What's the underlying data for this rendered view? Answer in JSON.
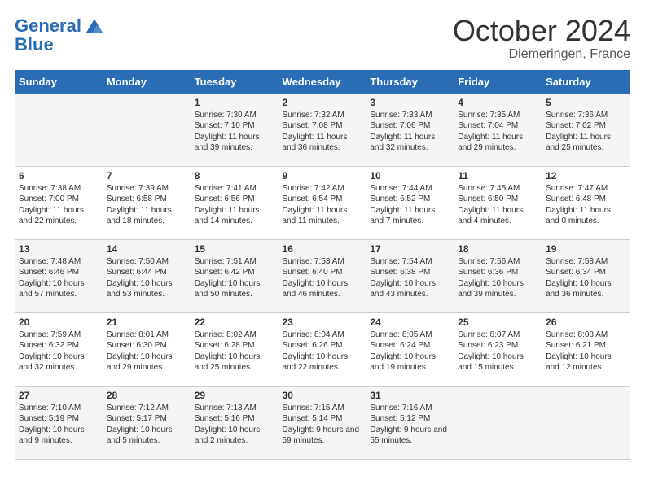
{
  "header": {
    "logo_line1": "General",
    "logo_line2": "Blue",
    "title": "October 2024",
    "subtitle": "Diemeringen, France"
  },
  "weekdays": [
    "Sunday",
    "Monday",
    "Tuesday",
    "Wednesday",
    "Thursday",
    "Friday",
    "Saturday"
  ],
  "weeks": [
    [
      {
        "day": "",
        "info": ""
      },
      {
        "day": "",
        "info": ""
      },
      {
        "day": "1",
        "info": "Sunrise: 7:30 AM\nSunset: 7:10 PM\nDaylight: 11 hours and 39 minutes."
      },
      {
        "day": "2",
        "info": "Sunrise: 7:32 AM\nSunset: 7:08 PM\nDaylight: 11 hours and 36 minutes."
      },
      {
        "day": "3",
        "info": "Sunrise: 7:33 AM\nSunset: 7:06 PM\nDaylight: 11 hours and 32 minutes."
      },
      {
        "day": "4",
        "info": "Sunrise: 7:35 AM\nSunset: 7:04 PM\nDaylight: 11 hours and 29 minutes."
      },
      {
        "day": "5",
        "info": "Sunrise: 7:36 AM\nSunset: 7:02 PM\nDaylight: 11 hours and 25 minutes."
      }
    ],
    [
      {
        "day": "6",
        "info": "Sunrise: 7:38 AM\nSunset: 7:00 PM\nDaylight: 11 hours and 22 minutes."
      },
      {
        "day": "7",
        "info": "Sunrise: 7:39 AM\nSunset: 6:58 PM\nDaylight: 11 hours and 18 minutes."
      },
      {
        "day": "8",
        "info": "Sunrise: 7:41 AM\nSunset: 6:56 PM\nDaylight: 11 hours and 14 minutes."
      },
      {
        "day": "9",
        "info": "Sunrise: 7:42 AM\nSunset: 6:54 PM\nDaylight: 11 hours and 11 minutes."
      },
      {
        "day": "10",
        "info": "Sunrise: 7:44 AM\nSunset: 6:52 PM\nDaylight: 11 hours and 7 minutes."
      },
      {
        "day": "11",
        "info": "Sunrise: 7:45 AM\nSunset: 6:50 PM\nDaylight: 11 hours and 4 minutes."
      },
      {
        "day": "12",
        "info": "Sunrise: 7:47 AM\nSunset: 6:48 PM\nDaylight: 11 hours and 0 minutes."
      }
    ],
    [
      {
        "day": "13",
        "info": "Sunrise: 7:48 AM\nSunset: 6:46 PM\nDaylight: 10 hours and 57 minutes."
      },
      {
        "day": "14",
        "info": "Sunrise: 7:50 AM\nSunset: 6:44 PM\nDaylight: 10 hours and 53 minutes."
      },
      {
        "day": "15",
        "info": "Sunrise: 7:51 AM\nSunset: 6:42 PM\nDaylight: 10 hours and 50 minutes."
      },
      {
        "day": "16",
        "info": "Sunrise: 7:53 AM\nSunset: 6:40 PM\nDaylight: 10 hours and 46 minutes."
      },
      {
        "day": "17",
        "info": "Sunrise: 7:54 AM\nSunset: 6:38 PM\nDaylight: 10 hours and 43 minutes."
      },
      {
        "day": "18",
        "info": "Sunrise: 7:56 AM\nSunset: 6:36 PM\nDaylight: 10 hours and 39 minutes."
      },
      {
        "day": "19",
        "info": "Sunrise: 7:58 AM\nSunset: 6:34 PM\nDaylight: 10 hours and 36 minutes."
      }
    ],
    [
      {
        "day": "20",
        "info": "Sunrise: 7:59 AM\nSunset: 6:32 PM\nDaylight: 10 hours and 32 minutes."
      },
      {
        "day": "21",
        "info": "Sunrise: 8:01 AM\nSunset: 6:30 PM\nDaylight: 10 hours and 29 minutes."
      },
      {
        "day": "22",
        "info": "Sunrise: 8:02 AM\nSunset: 6:28 PM\nDaylight: 10 hours and 25 minutes."
      },
      {
        "day": "23",
        "info": "Sunrise: 8:04 AM\nSunset: 6:26 PM\nDaylight: 10 hours and 22 minutes."
      },
      {
        "day": "24",
        "info": "Sunrise: 8:05 AM\nSunset: 6:24 PM\nDaylight: 10 hours and 19 minutes."
      },
      {
        "day": "25",
        "info": "Sunrise: 8:07 AM\nSunset: 6:23 PM\nDaylight: 10 hours and 15 minutes."
      },
      {
        "day": "26",
        "info": "Sunrise: 8:08 AM\nSunset: 6:21 PM\nDaylight: 10 hours and 12 minutes."
      }
    ],
    [
      {
        "day": "27",
        "info": "Sunrise: 7:10 AM\nSunset: 5:19 PM\nDaylight: 10 hours and 9 minutes."
      },
      {
        "day": "28",
        "info": "Sunrise: 7:12 AM\nSunset: 5:17 PM\nDaylight: 10 hours and 5 minutes."
      },
      {
        "day": "29",
        "info": "Sunrise: 7:13 AM\nSunset: 5:16 PM\nDaylight: 10 hours and 2 minutes."
      },
      {
        "day": "30",
        "info": "Sunrise: 7:15 AM\nSunset: 5:14 PM\nDaylight: 9 hours and 59 minutes."
      },
      {
        "day": "31",
        "info": "Sunrise: 7:16 AM\nSunset: 5:12 PM\nDaylight: 9 hours and 55 minutes."
      },
      {
        "day": "",
        "info": ""
      },
      {
        "day": "",
        "info": ""
      }
    ]
  ]
}
